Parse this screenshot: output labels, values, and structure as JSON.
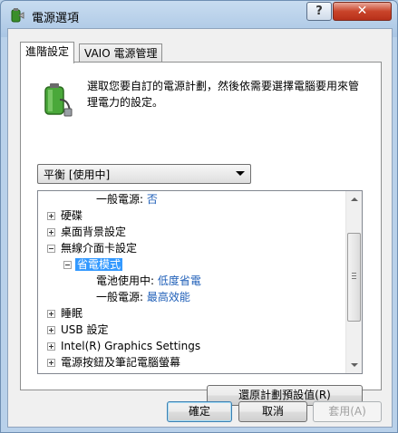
{
  "window": {
    "title": "電源選項"
  },
  "titlebar": {
    "help_label": "?",
    "close_label": "✕"
  },
  "tabs": [
    {
      "label": "進階設定"
    },
    {
      "label": "VAIO 電源管理"
    }
  ],
  "panel": {
    "description": "選取您要自訂的電源計劃，然後依需要選擇電腦要用來管理電力的設定。",
    "plan_select": {
      "value": "平衡 [使用中]"
    }
  },
  "tree": {
    "rows": [
      {
        "label": "一般電源:",
        "value": "否"
      },
      {
        "label": "硬碟"
      },
      {
        "label": "桌面背景設定"
      },
      {
        "label": "無線介面卡設定"
      },
      {
        "label": "省電模式"
      },
      {
        "label": "電池使用中:",
        "value": "低度省電"
      },
      {
        "label": "一般電源:",
        "value": "最高效能"
      },
      {
        "label": "睡眠"
      },
      {
        "label": "USB 設定"
      },
      {
        "label": "Intel(R) Graphics Settings"
      },
      {
        "label": "電源按鈕及筆記電腦螢幕"
      }
    ]
  },
  "buttons": {
    "restore": "還原計劃預設值(R)",
    "ok": "確定",
    "cancel": "取消",
    "apply": "套用(A)"
  },
  "icons": {
    "title": "power-plan-icon",
    "plan": "battery-plug-icon"
  },
  "colors": {
    "selection": "#3399ff",
    "value_text": "#1f5fb8",
    "close_button": "#c9442a"
  }
}
